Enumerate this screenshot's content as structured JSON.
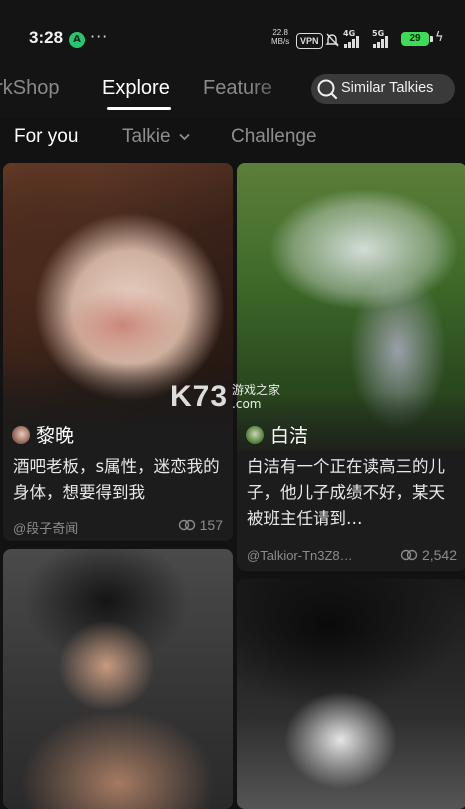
{
  "status_bar": {
    "time": "3:28",
    "app_icon_letter": "A",
    "speed_value": "22.8",
    "speed_unit": "MB/s",
    "vpn": "VPN",
    "sig1": "4G",
    "sig2": "5G",
    "battery": "29"
  },
  "tabs": {
    "workshop": "orkShop",
    "explore": "Explore",
    "featured": "Feature",
    "similar": "Similar Talkies"
  },
  "subtabs": {
    "foryou": "For you",
    "talkie": "Talkie",
    "challenge": "Challenge"
  },
  "cards": [
    {
      "name": "黎晚",
      "description": "酒吧老板，s属性，迷恋我的身体，想要得到我",
      "author": "@段子奇闻",
      "count": "157"
    },
    {
      "name": "白洁",
      "description": "白洁有一个正在读高三的儿子，他儿子成绩不好，某天被班主任请到…",
      "author": "@Talkior-Tn3Z8…",
      "count": "2,542"
    }
  ],
  "watermark": {
    "big": "K73",
    "line1": "游戏之家",
    "line2": ".com"
  },
  "colors": {
    "background": "#121212",
    "battery": "#3ddc58",
    "active_tab": "#ffffff",
    "inactive_tab": "#8a8a8a"
  }
}
